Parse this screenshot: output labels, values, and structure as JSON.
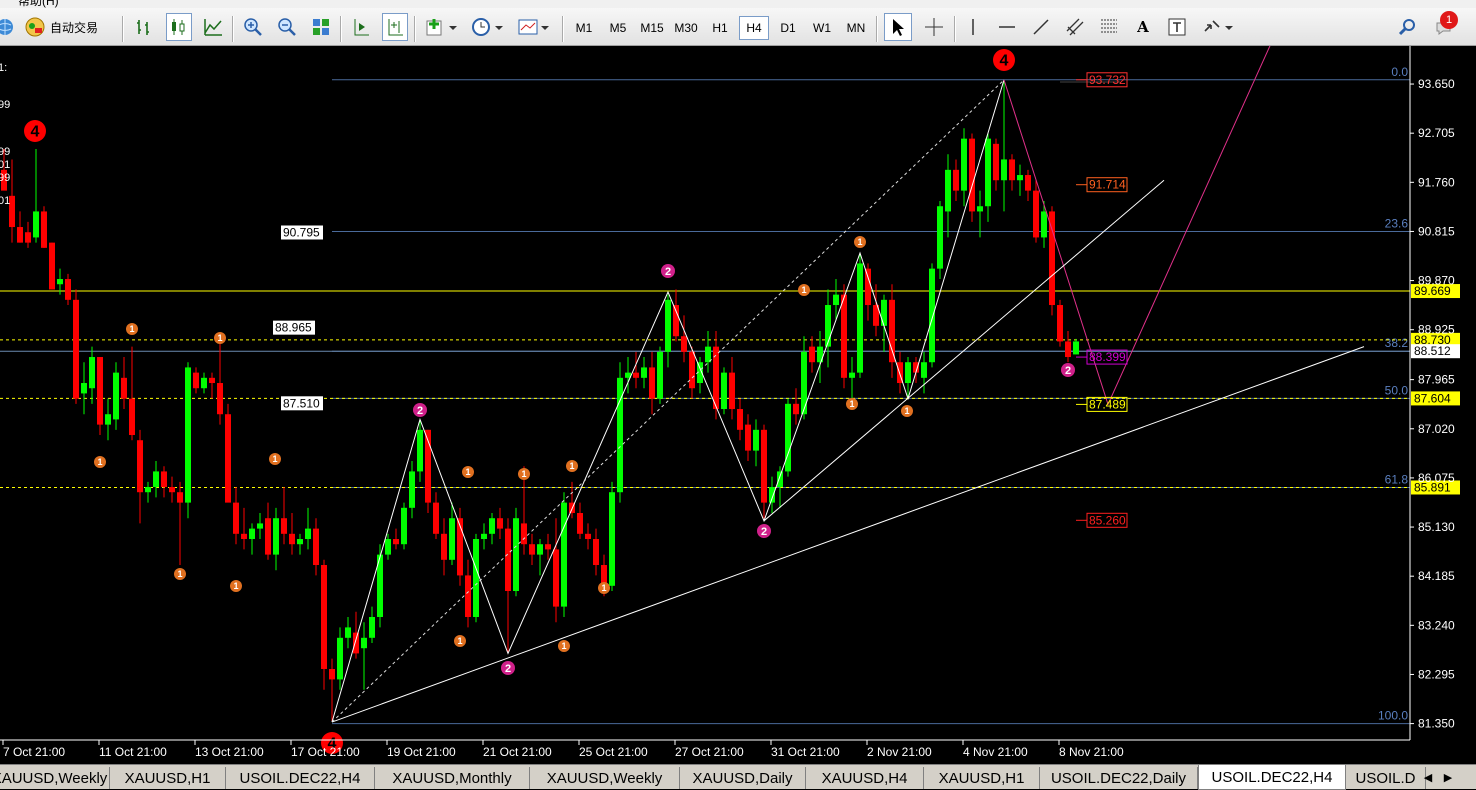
{
  "window": {
    "title_fragment": "帮助(H)"
  },
  "toolbar": {
    "auto_trade_label": "自动交易",
    "timeframes": [
      "M1",
      "M5",
      "M15",
      "M30",
      "H1",
      "H4",
      "D1",
      "W1",
      "MN"
    ],
    "active_timeframe": "H4",
    "notification_count": "1"
  },
  "chart": {
    "symbol": "USOIL.DEC22,H4",
    "background": "#000000",
    "bull_color": "#00ff00",
    "bear_color": "#ff0000",
    "price_axis": [
      "93.650",
      "92.705",
      "91.760",
      "90.815",
      "89.870",
      "88.925",
      "87.965",
      "87.020",
      "86.075",
      "85.130",
      "84.185",
      "83.240",
      "82.295",
      "81.350"
    ],
    "time_axis": [
      "7 Oct 21:00",
      "11 Oct 21:00",
      "13 Oct 21:00",
      "17 Oct 21:00",
      "19 Oct 21:00",
      "21 Oct 21:00",
      "25 Oct 21:00",
      "27 Oct 21:00",
      "31 Oct 21:00",
      "2 Nov 21:00",
      "4 Nov 21:00",
      "8 Nov 21:00"
    ],
    "axis_tags": [
      {
        "text": "89.669",
        "color": "#ffff00"
      },
      {
        "text": "88.730",
        "color": "#ffff00"
      },
      {
        "text": "88.512",
        "color": "#ffffff"
      },
      {
        "text": "87.604",
        "color": "#ffff00"
      },
      {
        "text": "85.891",
        "color": "#ffff00"
      }
    ],
    "fib_levels": [
      {
        "pct": "0.0",
        "price": 93.732
      },
      {
        "pct": "23.6",
        "price": 90.815
      },
      {
        "pct": "38.2",
        "price": 88.512
      },
      {
        "pct": "50.0",
        "price": 87.604
      },
      {
        "pct": "61.8",
        "price": 85.891
      },
      {
        "pct": "100.0",
        "price": 81.35
      }
    ],
    "horizontal_labels": [
      {
        "text": "90.795",
        "price": 90.795
      },
      {
        "text": "88.965",
        "price": 88.965
      },
      {
        "text": "87.510",
        "price": 87.51
      }
    ],
    "projection_labels": [
      {
        "text": "93.732",
        "color": "#ff3030",
        "price": 93.732
      },
      {
        "text": "91.714",
        "color": "#ff6020",
        "price": 91.714
      },
      {
        "text": "88.399",
        "color": "#d000d0",
        "price": 88.399
      },
      {
        "text": "87.489",
        "color": "#ffff00",
        "price": 87.489
      },
      {
        "text": "85.260",
        "color": "#ff2020",
        "price": 85.26
      }
    ],
    "left_clipped_labels": [
      "1:",
      "99",
      "99",
      "01",
      "99",
      "01"
    ],
    "wave_labels": [
      {
        "text": "4",
        "kind": "big"
      },
      {
        "text": "4",
        "kind": "big"
      },
      {
        "text": "4",
        "kind": "big"
      },
      {
        "text": "2",
        "kind": "magenta"
      },
      {
        "text": "2",
        "kind": "magenta"
      },
      {
        "text": "2",
        "kind": "magenta"
      },
      {
        "text": "2",
        "kind": "magenta"
      },
      {
        "text": "2",
        "kind": "magenta"
      },
      {
        "text": "1",
        "kind": "orange"
      },
      {
        "text": "1",
        "kind": "orange"
      },
      {
        "text": "1",
        "kind": "orange"
      },
      {
        "text": "1",
        "kind": "orange"
      },
      {
        "text": "1",
        "kind": "orange"
      },
      {
        "text": "1",
        "kind": "orange"
      },
      {
        "text": "1",
        "kind": "orange"
      },
      {
        "text": "1",
        "kind": "orange"
      },
      {
        "text": "1",
        "kind": "orange"
      },
      {
        "text": "1",
        "kind": "orange"
      },
      {
        "text": "1",
        "kind": "orange"
      },
      {
        "text": "1",
        "kind": "orange"
      },
      {
        "text": "1",
        "kind": "orange"
      },
      {
        "text": "1",
        "kind": "orange"
      },
      {
        "text": "1",
        "kind": "orange"
      },
      {
        "text": "1",
        "kind": "orange"
      },
      {
        "text": "1",
        "kind": "orange"
      },
      {
        "text": "1",
        "kind": "orange"
      }
    ]
  },
  "tabs": [
    "XAUUSD,Weekly",
    "XAUUSD,H1",
    "USOIL.DEC22,H4",
    "XAUUSD,Monthly",
    "XAUUSD,Weekly",
    "XAUUSD,Daily",
    "XAUUSD,H4",
    "XAUUSD,H1",
    "USOIL.DEC22,Daily",
    "USOIL.DEC22,H4",
    "USOIL.D"
  ],
  "active_tab_index": 9,
  "tab_nav": [
    "◀",
    "▶"
  ]
}
